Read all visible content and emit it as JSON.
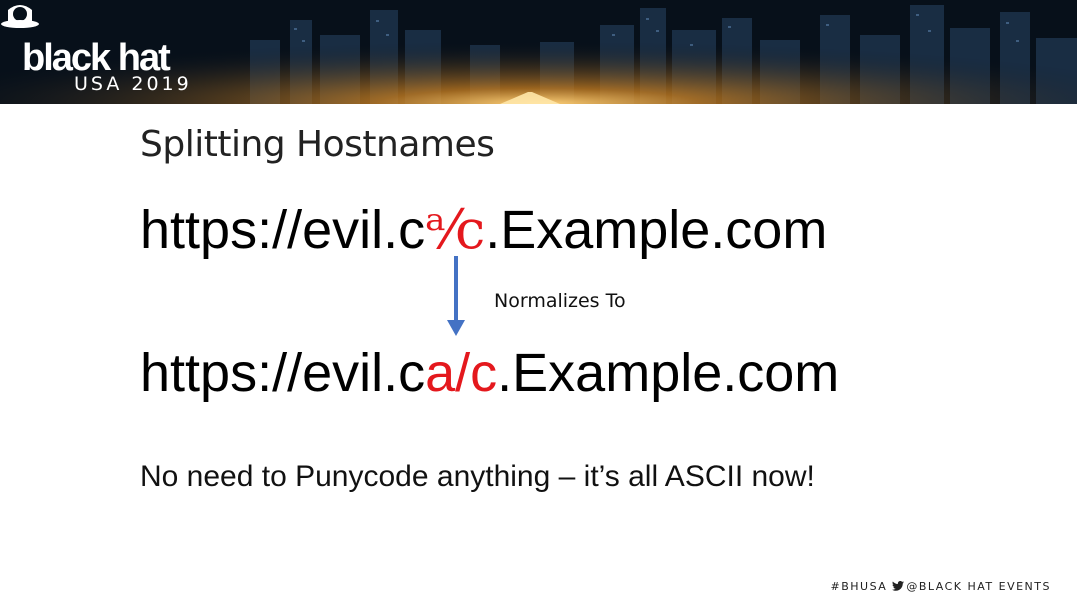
{
  "banner": {
    "brand_name": "black hat",
    "event_name": "USA 2019",
    "icon": "hat-icon"
  },
  "slide": {
    "title": "Splitting Hostnames",
    "url_original": {
      "prefix": "https://evil.c",
      "special": "ᵃ⁄c",
      "suffix": ".Example.com"
    },
    "arrow_icon": "arrow-down-icon",
    "arrow_color": "#4472c4",
    "caption": "Normalizes To",
    "url_normalized": {
      "prefix": "https://evil.c",
      "special": "a/c",
      "suffix": ".Example.com"
    },
    "note": "No need to Punycode anything – it’s all ASCII now!",
    "highlight_color": "#e4181d"
  },
  "footer": {
    "hashtag": "#BHUSA",
    "twitter_icon": "twitter-icon",
    "handle": "@BLACK HAT EVENTS"
  }
}
